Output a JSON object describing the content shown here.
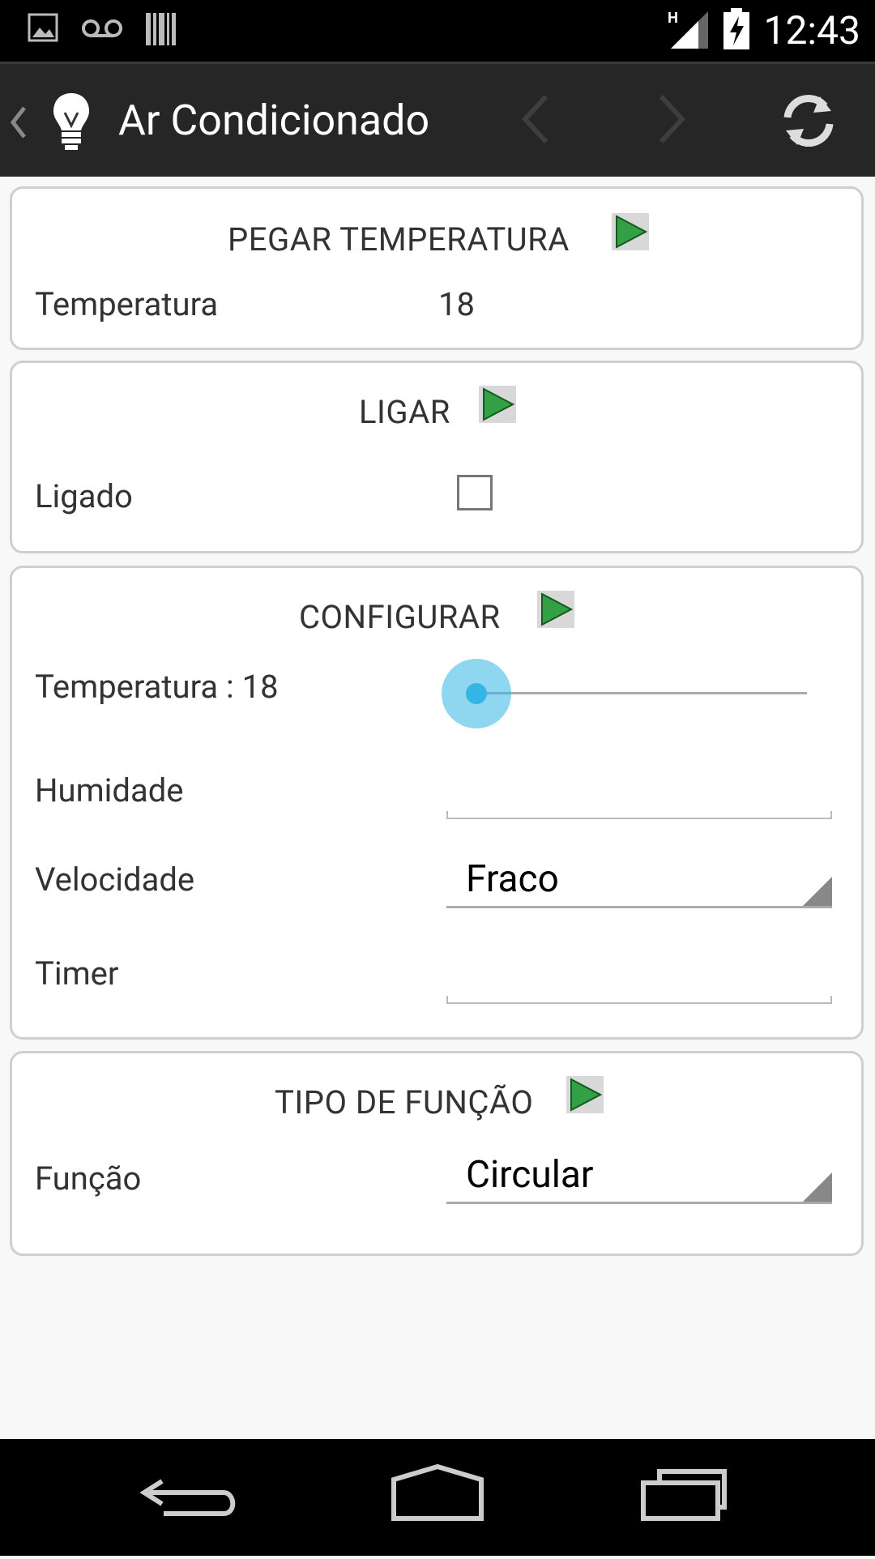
{
  "status_bar": {
    "time": "12:43",
    "network_type": "H",
    "left_icons": [
      "gallery-icon",
      "voicemail-icon",
      "barcode-icon"
    ],
    "right_icons": [
      "signal-icon",
      "battery-charging-icon"
    ]
  },
  "action_bar": {
    "title": "Ar Condicionado",
    "app_icon": "lightbulb-icon",
    "icons": [
      "back-caret-icon",
      "chevron-left-icon",
      "chevron-right-icon",
      "refresh-icon"
    ]
  },
  "sections": {
    "pegar": {
      "title": "PEGAR TEMPERATURA",
      "temperature_label": "Temperatura",
      "temperature_value": "18"
    },
    "ligar": {
      "title": "LIGAR",
      "ligado_label": "Ligado",
      "ligado_checked": false
    },
    "configurar": {
      "title": "CONFIGURAR",
      "temperature_label": "Temperatura : 18",
      "slider_level": 0,
      "humidity_label": "Humidade",
      "humidity_value": "",
      "speed_label": "Velocidade",
      "speed_value": "Fraco",
      "timer_label": "Timer",
      "timer_value": ""
    },
    "tipo": {
      "title": "TIPO DE FUNÇÃO",
      "function_label": "Função",
      "function_value": "Circular"
    }
  },
  "colors": {
    "accent": "#33b5e5",
    "play_green": "#2e8b3a",
    "action_bar_bg": "#262626"
  },
  "nav_bar": {
    "icons": [
      "back-icon",
      "home-icon",
      "recent-apps-icon"
    ]
  }
}
